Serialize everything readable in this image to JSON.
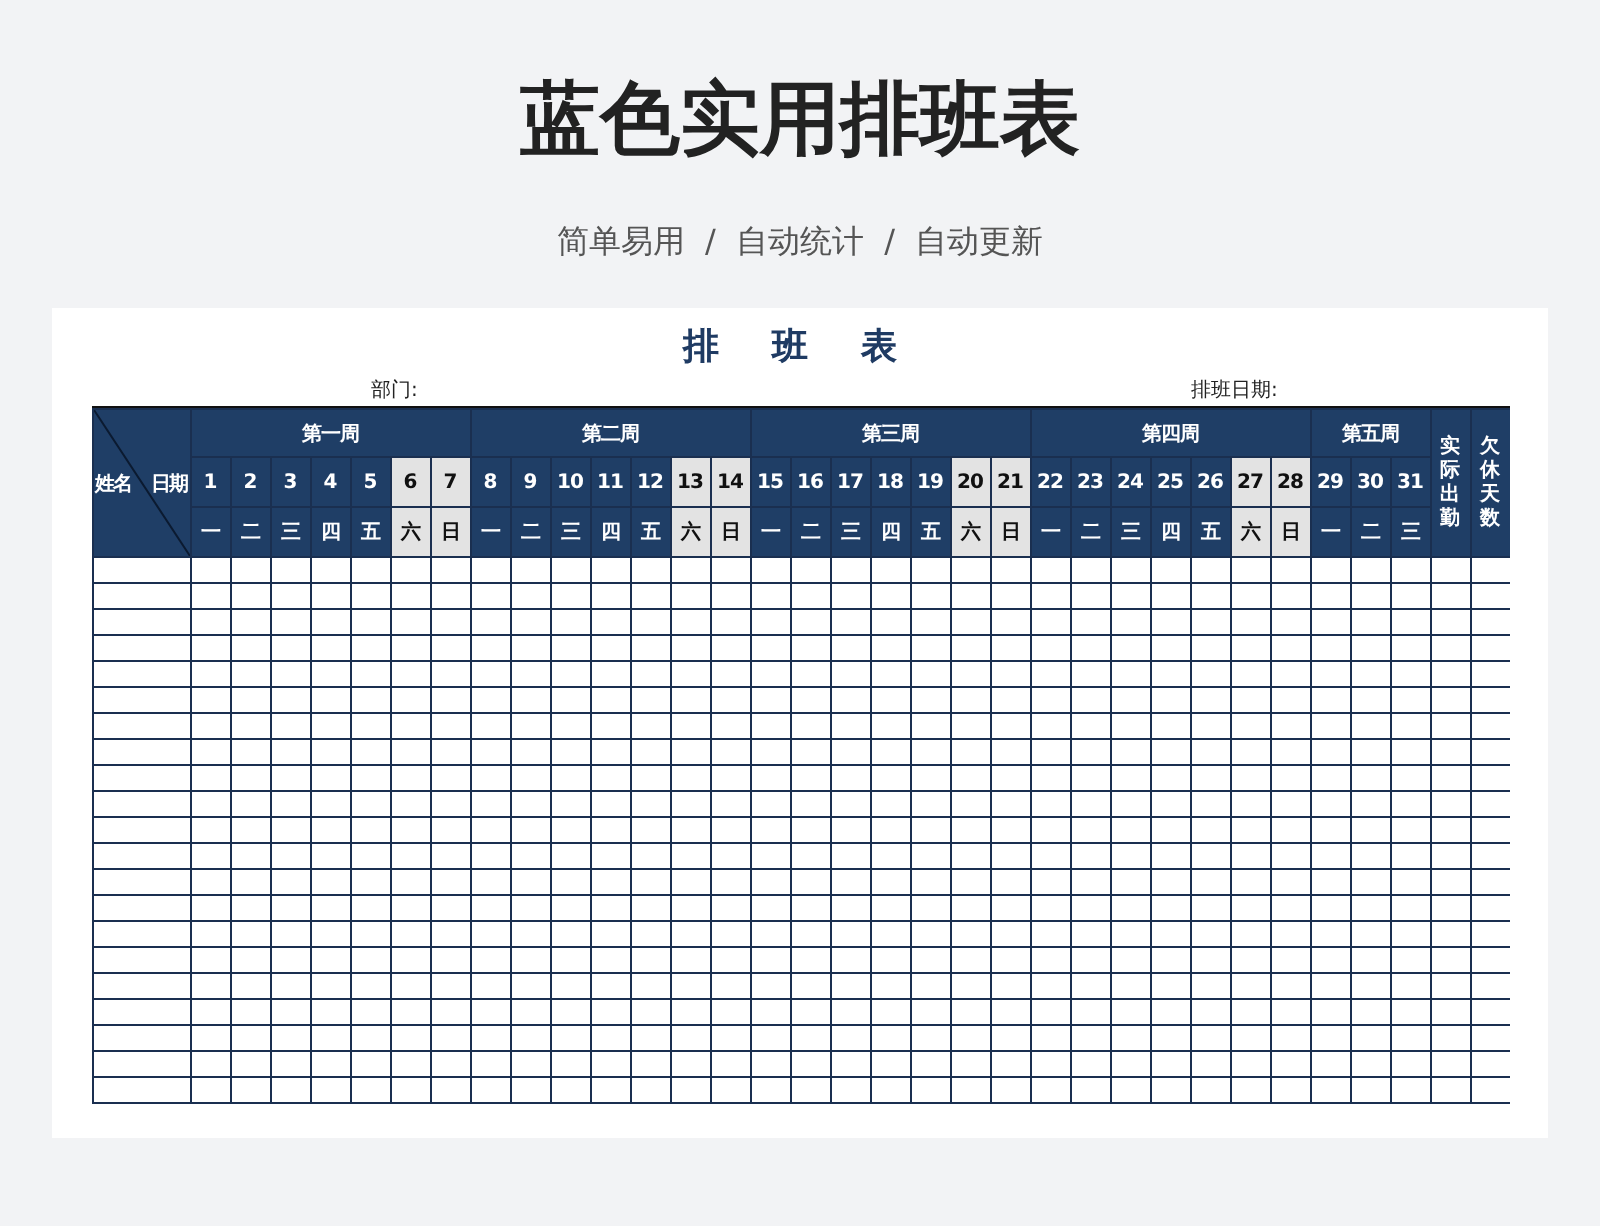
{
  "page": {
    "title": "蓝色实用排班表",
    "subtitle": "简单易用  /  自动统计  /  自动更新"
  },
  "sheet": {
    "title": "排 班 表",
    "department_label": "部门:",
    "date_label": "排班日期:",
    "corner": {
      "row_label": "姓名",
      "column_label": "日期"
    },
    "weeks": [
      {
        "label": "第一周",
        "days": [
          {
            "day": "1",
            "weekday": "一",
            "weekend": false
          },
          {
            "day": "2",
            "weekday": "二",
            "weekend": false
          },
          {
            "day": "3",
            "weekday": "三",
            "weekend": false
          },
          {
            "day": "4",
            "weekday": "四",
            "weekend": false
          },
          {
            "day": "5",
            "weekday": "五",
            "weekend": false
          },
          {
            "day": "6",
            "weekday": "六",
            "weekend": true
          },
          {
            "day": "7",
            "weekday": "日",
            "weekend": true
          }
        ]
      },
      {
        "label": "第二周",
        "days": [
          {
            "day": "8",
            "weekday": "一",
            "weekend": false
          },
          {
            "day": "9",
            "weekday": "二",
            "weekend": false
          },
          {
            "day": "10",
            "weekday": "三",
            "weekend": false
          },
          {
            "day": "11",
            "weekday": "四",
            "weekend": false
          },
          {
            "day": "12",
            "weekday": "五",
            "weekend": false
          },
          {
            "day": "13",
            "weekday": "六",
            "weekend": true
          },
          {
            "day": "14",
            "weekday": "日",
            "weekend": true
          }
        ]
      },
      {
        "label": "第三周",
        "days": [
          {
            "day": "15",
            "weekday": "一",
            "weekend": false
          },
          {
            "day": "16",
            "weekday": "二",
            "weekend": false
          },
          {
            "day": "17",
            "weekday": "三",
            "weekend": false
          },
          {
            "day": "18",
            "weekday": "四",
            "weekend": false
          },
          {
            "day": "19",
            "weekday": "五",
            "weekend": false
          },
          {
            "day": "20",
            "weekday": "六",
            "weekend": true
          },
          {
            "day": "21",
            "weekday": "日",
            "weekend": true
          }
        ]
      },
      {
        "label": "第四周",
        "days": [
          {
            "day": "22",
            "weekday": "一",
            "weekend": false
          },
          {
            "day": "23",
            "weekday": "二",
            "weekend": false
          },
          {
            "day": "24",
            "weekday": "三",
            "weekend": false
          },
          {
            "day": "25",
            "weekday": "四",
            "weekend": false
          },
          {
            "day": "26",
            "weekday": "五",
            "weekend": false
          },
          {
            "day": "27",
            "weekday": "六",
            "weekend": true
          },
          {
            "day": "28",
            "weekday": "日",
            "weekend": true
          }
        ]
      },
      {
        "label": "第五周",
        "days": [
          {
            "day": "29",
            "weekday": "一",
            "weekend": false
          },
          {
            "day": "30",
            "weekday": "二",
            "weekend": false
          },
          {
            "day": "31",
            "weekday": "三",
            "weekend": false
          }
        ]
      }
    ],
    "summary_columns": [
      "实际出勤",
      "欠休天数"
    ]
  }
}
